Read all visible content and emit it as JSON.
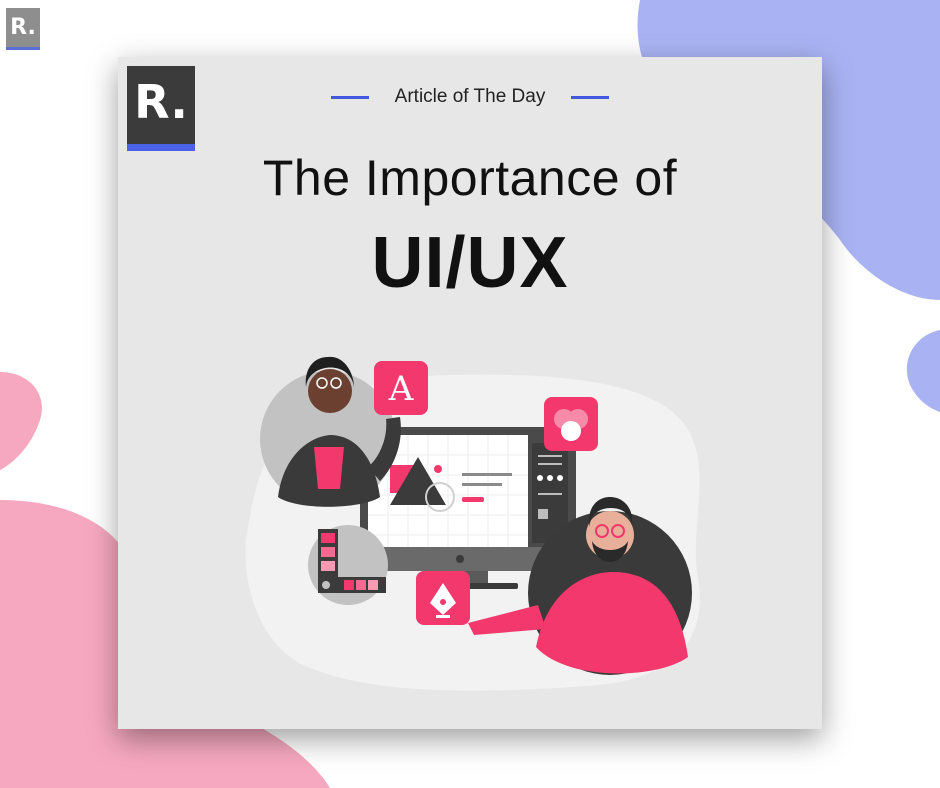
{
  "brand": {
    "logo_text": "R."
  },
  "card": {
    "kicker": "Article of The Day",
    "title": "The Importance of",
    "headline": "UI/UX"
  },
  "colors": {
    "accent_blue": "#4a62e8",
    "blob_blue": "#a9b3f3",
    "blob_pink": "#f6a8c0",
    "illustration_pink": "#f2386d",
    "card_bg": "#e7e7e7"
  },
  "illustration": {
    "icons": [
      "letter-a-icon",
      "color-blend-icon",
      "pen-tool-icon",
      "color-swatch-icon"
    ],
    "letter_a_text": "A"
  }
}
